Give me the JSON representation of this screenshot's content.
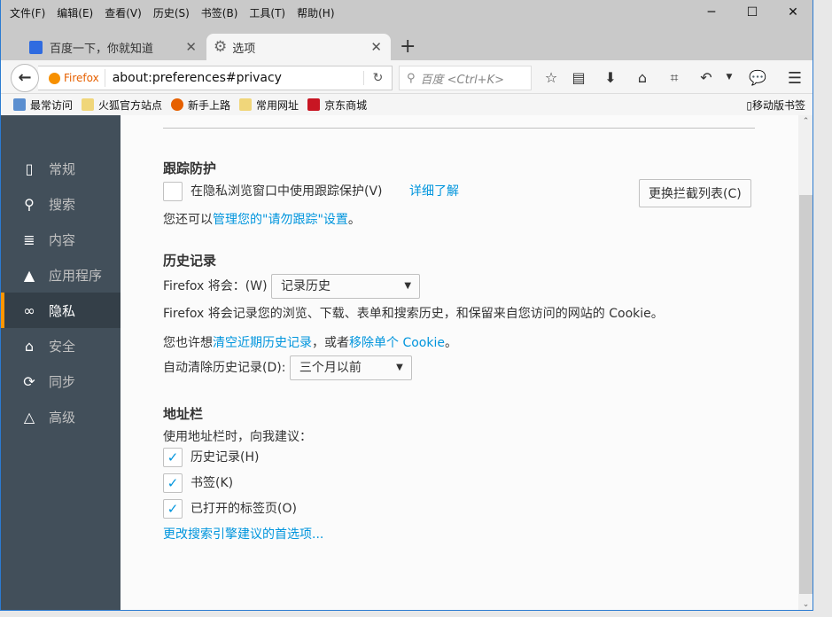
{
  "menu": [
    "文件(F)",
    "编辑(E)",
    "查看(V)",
    "历史(S)",
    "书签(B)",
    "工具(T)",
    "帮助(H)"
  ],
  "window_controls": {
    "minimize": "─",
    "maximize": "☐",
    "close": "✕"
  },
  "tabs": [
    {
      "title": "百度一下，你就知道",
      "icon": "baidu-icon"
    },
    {
      "title": "选项",
      "icon": "gear-icon",
      "active": true
    }
  ],
  "new_tab": "+",
  "nav": {
    "identity": "Firefox",
    "url": "about:preferences#privacy",
    "search_placeholder": "百度 <Ctrl+K>"
  },
  "bookmarks": [
    {
      "label": "最常访问",
      "color": "#5b8fd0"
    },
    {
      "label": "火狐官方站点",
      "color": "#f0d67a"
    },
    {
      "label": "新手上路",
      "color": "#e66000"
    },
    {
      "label": "常用网址",
      "color": "#f0d67a"
    },
    {
      "label": "京东商城",
      "color": "#c81623"
    }
  ],
  "mobile_bookmarks": "移动版书签",
  "sidebar": [
    {
      "label": "常规",
      "icon": "▯"
    },
    {
      "label": "搜索",
      "icon": "⚲"
    },
    {
      "label": "内容",
      "icon": "≣"
    },
    {
      "label": "应用程序",
      "icon": "▲"
    },
    {
      "label": "隐私",
      "icon": "∞",
      "selected": true
    },
    {
      "label": "安全",
      "icon": "⌂"
    },
    {
      "label": "同步",
      "icon": "⟳"
    },
    {
      "label": "高级",
      "icon": "△"
    }
  ],
  "tracking": {
    "heading": "跟踪防护",
    "checkbox": "在隐私浏览窗口中使用跟踪保护(V)",
    "learn_more": "详细了解",
    "change_list": "更换拦截列表(C)",
    "dnt_prefix": "您还可以",
    "dnt_link": "管理您的\"请勿跟踪\"设置",
    "dnt_suffix": "。"
  },
  "history": {
    "heading": "历史记录",
    "will_label": "Firefox 将会：(W)",
    "will_value": "记录历史",
    "desc": "Firefox 将会记录您的浏览、下载、表单和搜索历史，和保留来自您访问的网站的 Cookie。",
    "maybe": "您也许想",
    "clear_link": "清空近期历史记录",
    "or": "，或者",
    "remove_link": "移除单个 Cookie",
    "end": "。",
    "auto_label": "自动清除历史记录(D):",
    "auto_value": "三个月以前"
  },
  "urlbar": {
    "heading": "地址栏",
    "desc": "使用地址栏时，向我建议：",
    "options": [
      {
        "label": "历史记录(H)",
        "checked": true
      },
      {
        "label": "书签(K)",
        "checked": true
      },
      {
        "label": "已打开的标签页(O)",
        "checked": true
      }
    ],
    "search_link": "更改搜索引擎建议的首选项..."
  },
  "check": "✓"
}
